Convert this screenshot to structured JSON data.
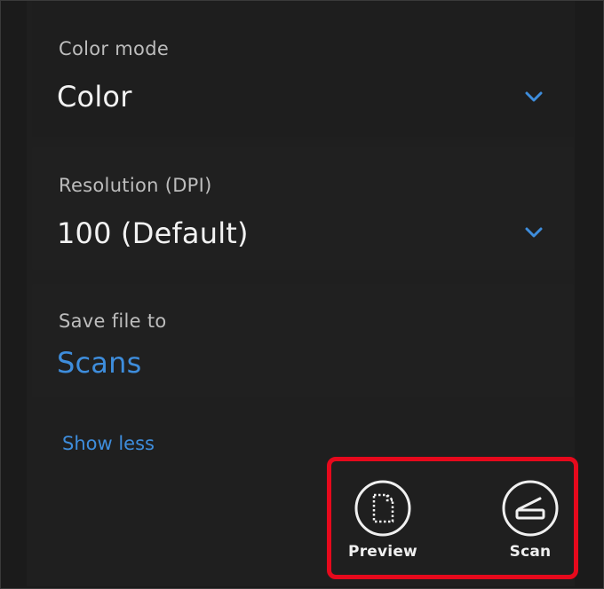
{
  "settings": {
    "color_mode": {
      "label": "Color mode",
      "value": "Color"
    },
    "resolution": {
      "label": "Resolution (DPI)",
      "value": "100 (Default)"
    },
    "save_file": {
      "label": "Save file to",
      "value": "Scans"
    },
    "show_less_label": "Show less"
  },
  "actions": {
    "preview_label": "Preview",
    "scan_label": "Scan"
  },
  "icons": {
    "dropdown": "chevron-down-icon",
    "preview": "document-dotted-icon",
    "scan": "scanner-icon"
  },
  "colors": {
    "accent": "#3e8ddc",
    "highlight": "#e6091c",
    "background": "#1b1b1b"
  }
}
